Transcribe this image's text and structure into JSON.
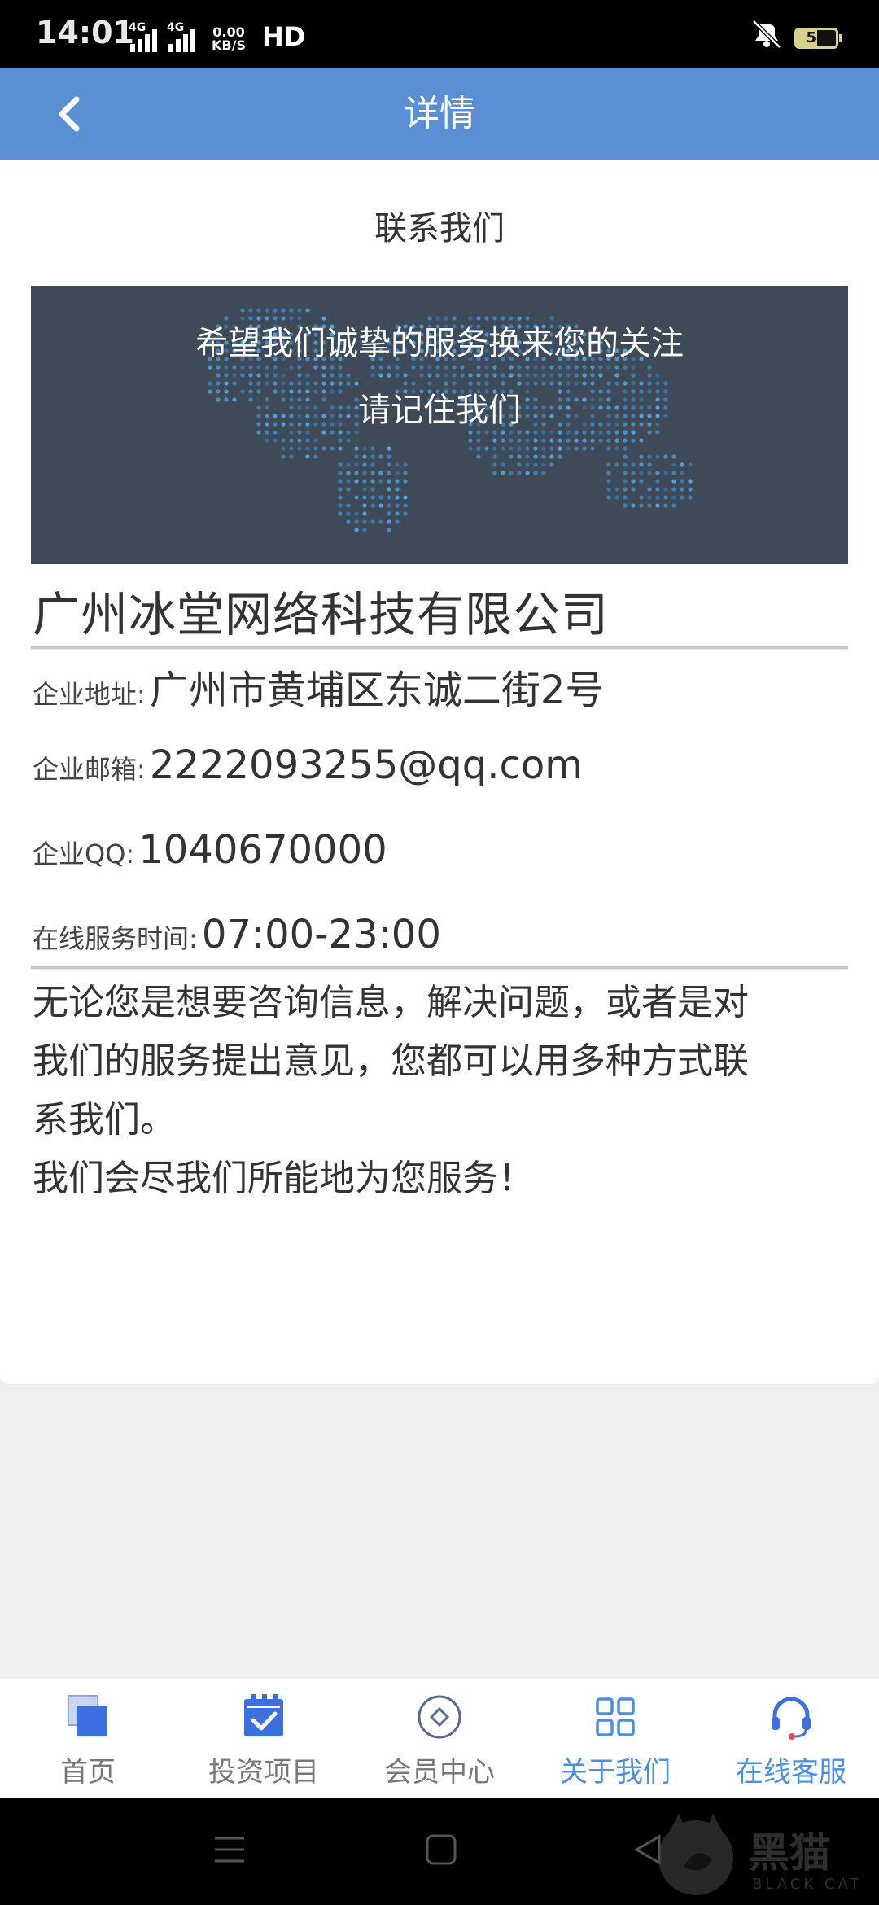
{
  "status_bar": {
    "time": "14:01",
    "network_1": "4G",
    "network_2": "4G",
    "speed_value": "0.00",
    "speed_unit": "KB/S",
    "hd": "HD",
    "battery": "51"
  },
  "header": {
    "title": "详情",
    "back_icon": "chevron-left-icon"
  },
  "content": {
    "section_title": "联系我们",
    "banner": {
      "line1": "希望我们诚挚的服务换来您的关注",
      "line2": "请记住我们"
    },
    "company_name": "广州冰堂网络科技有限公司",
    "info": {
      "address_label": "企业地址:",
      "address_value": "广州市黄埔区东诚二街2号",
      "email_label": "企业邮箱:",
      "email_value": "2222093255@qq.com",
      "qq_label": "企业QQ:",
      "qq_value": "1040670000",
      "hours_label": "在线服务时间:",
      "hours_value": "07:00-23:00"
    },
    "description": [
      "无论您是想要咨询信息，解决问题，或者是对",
      "我们的服务提出意见，您都可以用多种方式联",
      "系我们。",
      "我们会尽我们所能地为您服务！"
    ]
  },
  "bottom_nav": {
    "items": [
      {
        "label": "首页",
        "icon": "home-icon"
      },
      {
        "label": "投资项目",
        "icon": "calendar-check-icon"
      },
      {
        "label": "会员中心",
        "icon": "diamond-icon"
      },
      {
        "label": "关于我们",
        "icon": "grid-icon"
      },
      {
        "label": "在线客服",
        "icon": "headset-icon"
      }
    ],
    "active_index": 3
  },
  "watermark": {
    "text": "黑猫",
    "sub": "BLACK CAT"
  },
  "colors": {
    "header": "#5b8fd4",
    "accent": "#4a8ee6",
    "banner": "#3f4a59"
  }
}
